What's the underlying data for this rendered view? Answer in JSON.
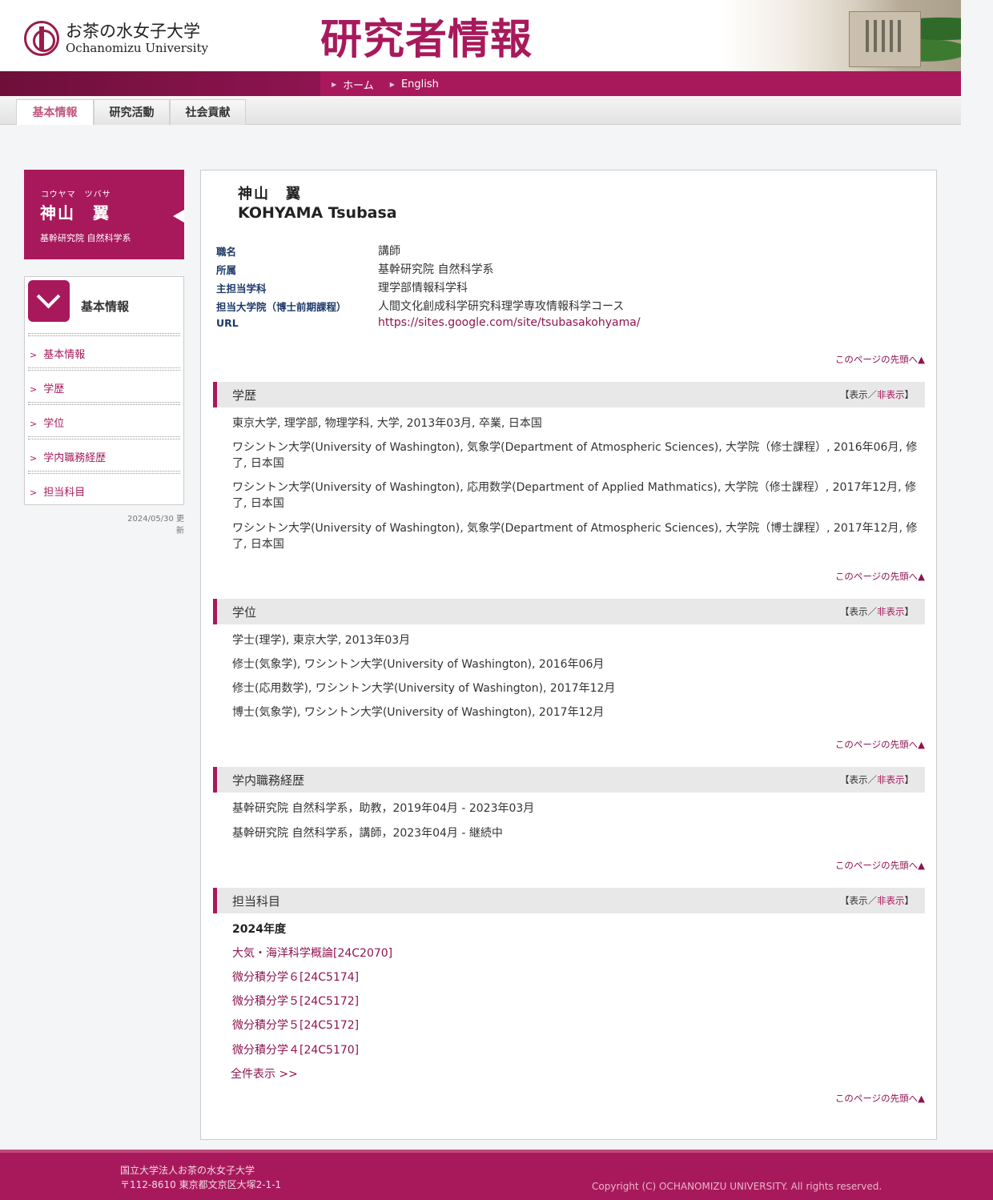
{
  "header": {
    "logo_jp": "お茶の水女子大学",
    "logo_en": "Ochanomizu University",
    "site_title": "研究者情報",
    "nav": [
      {
        "label": "ホーム"
      },
      {
        "label": "English"
      }
    ]
  },
  "tabs": [
    {
      "label": "基本情報",
      "active": true
    },
    {
      "label": "研究活動",
      "active": false
    },
    {
      "label": "社会貢献",
      "active": false
    }
  ],
  "profile": {
    "kana": "コウヤマ　ツバサ",
    "name_jp": "神山　翼",
    "name_en": "KOHYAMA Tsubasa",
    "dept": "基幹研究院 自然科学系"
  },
  "sidebar": {
    "heading": "基本情報",
    "items": [
      {
        "label": "基本情報"
      },
      {
        "label": "学歴"
      },
      {
        "label": "学位"
      },
      {
        "label": "学内職務経歴"
      },
      {
        "label": "担当科目"
      }
    ],
    "updated": "2024/05/30 更新"
  },
  "info": [
    {
      "label": "職名",
      "value": "講師"
    },
    {
      "label": "所属",
      "value": "基幹研究院 自然科学系"
    },
    {
      "label": "主担当学科",
      "value": "理学部情報科学科"
    },
    {
      "label": "担当大学院（博士前期課程）",
      "value": "人間文化創成科学研究科理学専攻情報科学コース"
    },
    {
      "label": "URL",
      "value": "https://sites.google.com/site/tsubasakohyama/"
    }
  ],
  "to_top": "このページの先頭へ▲",
  "toggle": {
    "open": "【",
    "show": "表示",
    "slash": "／",
    "hide": "非表示",
    "close": "】"
  },
  "sections": {
    "education": {
      "title": "学歴",
      "entries": [
        "東京大学, 理学部, 物理学科, 大学, 2013年03月, 卒業, 日本国",
        "ワシントン大学(University of Washington), 気象学(Department of Atmospheric Sciences), 大学院（修士課程）, 2016年06月, 修了, 日本国",
        "ワシントン大学(University of Washington), 応用数学(Department of Applied Mathmatics), 大学院（修士課程）, 2017年12月, 修了, 日本国",
        "ワシントン大学(University of Washington), 気象学(Department of Atmospheric Sciences), 大学院（博士課程）, 2017年12月, 修了, 日本国"
      ]
    },
    "degrees": {
      "title": "学位",
      "entries": [
        "学士(理学), 東京大学, 2013年03月",
        "修士(気象学), ワシントン大学(University of Washington), 2016年06月",
        "修士(応用数学), ワシントン大学(University of Washington), 2017年12月",
        "博士(気象学), ワシントン大学(University of Washington), 2017年12月"
      ]
    },
    "career": {
      "title": "学内職務経歴",
      "entries": [
        "基幹研究院 自然科学系，助教，2019年04月 - 2023年03月",
        "基幹研究院 自然科学系，講師，2023年04月 - 継続中"
      ]
    },
    "courses": {
      "title": "担当科目",
      "year": "2024年度",
      "entries": [
        "大気・海洋科学概論[24C2070]",
        "微分積分学６[24C5174]",
        "微分積分学５[24C5172]",
        "微分積分学５[24C5172]",
        "微分積分学４[24C5170]"
      ],
      "show_all": "全件表示 >>"
    }
  },
  "footer": {
    "org": "国立大学法人お茶の水女子大学",
    "address": "〒112-8610 東京都文京区大塚2-1-1",
    "copyright": "Copyright (C) OCHANOMIZU UNIVERSITY. All rights reserved."
  },
  "colors": {
    "brand": "#a8195c",
    "link": "#8e1450",
    "label": "#1e3a6a"
  }
}
